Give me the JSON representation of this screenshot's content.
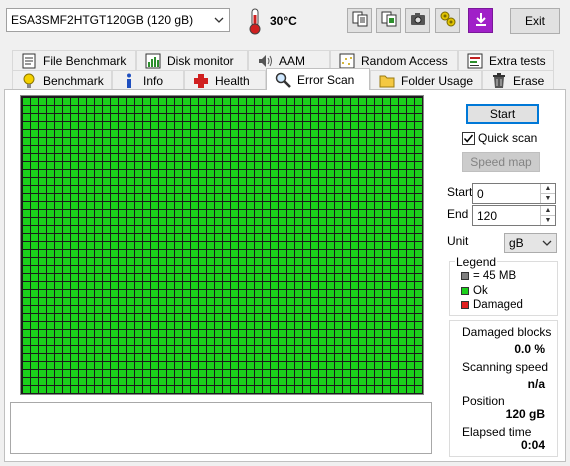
{
  "toolbar": {
    "drive": "ESA3SMF2HTGT120GB (120 gB)",
    "temperature": "30°C",
    "exit_label": "Exit",
    "icons": [
      "copy-text-icon",
      "copy-info-icon",
      "screenshot-camera-icon",
      "options-icon",
      "save-down-icon"
    ]
  },
  "tabs": {
    "row1": [
      {
        "label": "File Benchmark",
        "icon": "file-benchmark-icon"
      },
      {
        "label": "Disk monitor",
        "icon": "disk-monitor-icon"
      },
      {
        "label": "AAM",
        "icon": "speaker-icon"
      },
      {
        "label": "Random Access",
        "icon": "random-access-icon"
      },
      {
        "label": "Extra tests",
        "icon": "extra-tests-icon"
      }
    ],
    "row2": [
      {
        "label": "Benchmark",
        "icon": "benchmark-bulb-icon"
      },
      {
        "label": "Info",
        "icon": "info-icon"
      },
      {
        "label": "Health",
        "icon": "health-cross-icon"
      },
      {
        "label": "Error Scan",
        "icon": "magnifier-icon"
      },
      {
        "label": "Folder Usage",
        "icon": "folder-icon"
      },
      {
        "label": "Erase",
        "icon": "trash-icon"
      }
    ],
    "active": "Error Scan"
  },
  "scan": {
    "start_label": "Start",
    "quick_scan_label": "Quick scan",
    "quick_scan_checked": true,
    "speed_map_label": "Speed map",
    "start_field_label": "Start",
    "start_value": "0",
    "end_field_label": "End",
    "end_value": "120",
    "unit_label": "Unit",
    "unit_value": "gB"
  },
  "legend": {
    "title": "Legend",
    "items": [
      {
        "label": "= 45 MB",
        "color": "#808080"
      },
      {
        "label": "Ok",
        "color": "#1bd01b"
      },
      {
        "label": "Damaged",
        "color": "#e02020"
      }
    ]
  },
  "stats": {
    "damaged_label": "Damaged blocks",
    "damaged_value": "0.0 %",
    "speed_label": "Scanning speed",
    "speed_value": "n/a",
    "position_label": "Position",
    "position_value": "120 gB",
    "elapsed_label": "Elapsed time",
    "elapsed_value": "0:04"
  },
  "colors": {
    "ok_block": "#1bd01b",
    "accent": "#0078d7"
  }
}
